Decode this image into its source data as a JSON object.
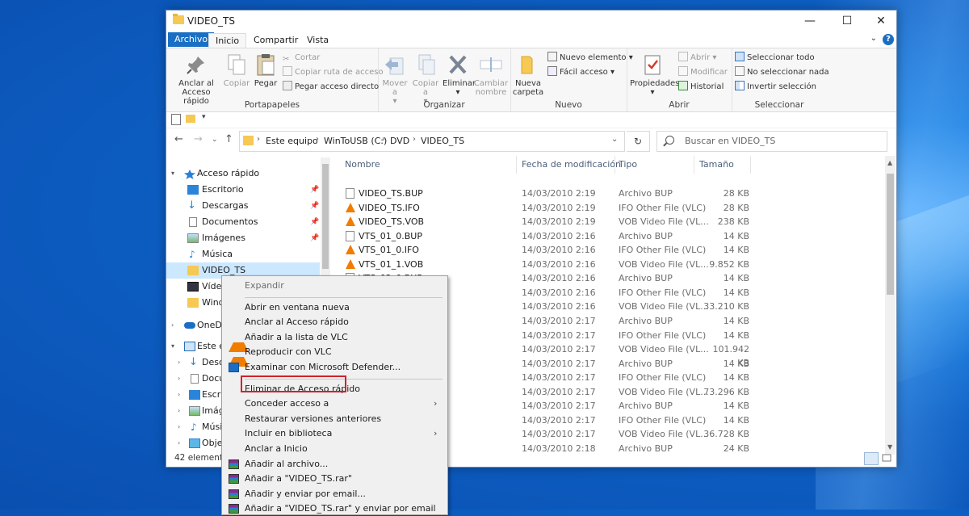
{
  "window": {
    "title": "VIDEO_TS",
    "minimize": "—",
    "maximize": "☐",
    "close": "✕"
  },
  "ribbon_tabs": [
    "Archivo",
    "Inicio",
    "Compartir",
    "Vista"
  ],
  "ribbon": {
    "portapapeles": {
      "label": "Portapapeles",
      "pin": "Anclar al Acceso rápido",
      "copy": "Copiar",
      "paste": "Pegar",
      "cut": "Cortar",
      "copy_path": "Copiar ruta de acceso",
      "paste_shortcut": "Pegar acceso directo"
    },
    "organizar": {
      "label": "Organizar",
      "move": "Mover a",
      "copy_to": "Copiar a",
      "delete": "Eliminar",
      "rename": "Cambiar nombre"
    },
    "nuevo": {
      "label": "Nuevo",
      "new_folder": "Nueva carpeta",
      "new_item": "Nuevo elemento",
      "easy_access": "Fácil acceso"
    },
    "abrir": {
      "label": "Abrir",
      "properties": "Propiedades",
      "open": "Abrir",
      "edit": "Modificar",
      "history": "Historial"
    },
    "seleccionar": {
      "label": "Seleccionar",
      "select_all": "Seleccionar todo",
      "select_none": "No seleccionar nada",
      "invert": "Invertir selección"
    }
  },
  "address": {
    "crumbs": [
      "Este equipo",
      "WinToUSB (C:)",
      "DVD",
      "VIDEO_TS"
    ],
    "search_placeholder": "Buscar en VIDEO_TS"
  },
  "nav": {
    "quick_access": "Acceso rápido",
    "items": [
      "Escritorio",
      "Descargas",
      "Documentos",
      "Imágenes",
      "Música",
      "VIDEO_TS",
      "Víde",
      "Wind"
    ],
    "onedrive": "OneDr",
    "this_pc": "Este ec",
    "pc_items": [
      "Desca",
      "Docu",
      "Escri",
      "Imág",
      "Músi",
      "Objet"
    ]
  },
  "columns": {
    "name": "Nombre",
    "date": "Fecha de modificación",
    "type": "Tipo",
    "size": "Tamaño"
  },
  "files": [
    {
      "name": "VIDEO_TS.BUP",
      "date": "14/03/2010 2:19",
      "type": "Archivo BUP",
      "size": "28 KB",
      "icon": "doc"
    },
    {
      "name": "VIDEO_TS.IFO",
      "date": "14/03/2010 2:19",
      "type": "IFO Other File (VLC)",
      "size": "28 KB",
      "icon": "vlc"
    },
    {
      "name": "VIDEO_TS.VOB",
      "date": "14/03/2010 2:19",
      "type": "VOB Video File (VL...",
      "size": "238 KB",
      "icon": "vlc"
    },
    {
      "name": "VTS_01_0.BUP",
      "date": "14/03/2010 2:16",
      "type": "Archivo BUP",
      "size": "14 KB",
      "icon": "doc"
    },
    {
      "name": "VTS_01_0.IFO",
      "date": "14/03/2010 2:16",
      "type": "IFO Other File (VLC)",
      "size": "14 KB",
      "icon": "vlc"
    },
    {
      "name": "VTS_01_1.VOB",
      "date": "14/03/2010 2:16",
      "type": "VOB Video File (VL...",
      "size": "9.852 KB",
      "icon": "vlc"
    },
    {
      "name": "VTS_02_0.BUP",
      "date": "14/03/2010 2:16",
      "type": "Archivo BUP",
      "size": "14 KB",
      "icon": "doc"
    },
    {
      "name": "",
      "date": "14/03/2010 2:16",
      "type": "IFO Other File (VLC)",
      "size": "14 KB",
      "icon": ""
    },
    {
      "name": "",
      "date": "14/03/2010 2:16",
      "type": "VOB Video File (VL...",
      "size": "33.210 KB",
      "icon": ""
    },
    {
      "name": "",
      "date": "14/03/2010 2:17",
      "type": "Archivo BUP",
      "size": "14 KB",
      "icon": ""
    },
    {
      "name": "",
      "date": "14/03/2010 2:17",
      "type": "IFO Other File (VLC)",
      "size": "14 KB",
      "icon": ""
    },
    {
      "name": "",
      "date": "14/03/2010 2:17",
      "type": "VOB Video File (VL...",
      "size": "101.942 KB",
      "icon": ""
    },
    {
      "name": "",
      "date": "14/03/2010 2:17",
      "type": "Archivo BUP",
      "size": "14 KB",
      "icon": ""
    },
    {
      "name": "",
      "date": "14/03/2010 2:17",
      "type": "IFO Other File (VLC)",
      "size": "14 KB",
      "icon": ""
    },
    {
      "name": "",
      "date": "14/03/2010 2:17",
      "type": "VOB Video File (VL...",
      "size": "73.296 KB",
      "icon": ""
    },
    {
      "name": "",
      "date": "14/03/2010 2:17",
      "type": "Archivo BUP",
      "size": "14 KB",
      "icon": ""
    },
    {
      "name": "",
      "date": "14/03/2010 2:17",
      "type": "IFO Other File (VLC)",
      "size": "14 KB",
      "icon": ""
    },
    {
      "name": "",
      "date": "14/03/2010 2:17",
      "type": "VOB Video File (VL...",
      "size": "36.728 KB",
      "icon": ""
    },
    {
      "name": "",
      "date": "14/03/2010 2:18",
      "type": "Archivo BUP",
      "size": "24 KB",
      "icon": ""
    }
  ],
  "status": {
    "count": "42 elemento"
  },
  "context_menu": [
    {
      "label": "Expandir",
      "disabled": true,
      "icon": ""
    },
    {
      "sep": true
    },
    {
      "label": "Abrir en ventana nueva",
      "icon": ""
    },
    {
      "label": "Anclar al Acceso rápido",
      "icon": ""
    },
    {
      "label": "Añadir a la lista de VLC",
      "icon": "vlc"
    },
    {
      "label": "Reproducir con VLC",
      "icon": "vlc"
    },
    {
      "label": "Examinar con Microsoft Defender...",
      "icon": "defender"
    },
    {
      "sep": true
    },
    {
      "label": "Eliminar de Acceso rápido",
      "icon": ""
    },
    {
      "label": "Conceder acceso a",
      "icon": "",
      "submenu": true
    },
    {
      "label": "Restaurar versiones anteriores",
      "icon": ""
    },
    {
      "label": "Incluir en biblioteca",
      "icon": "",
      "submenu": true
    },
    {
      "label": "Anclar a Inicio",
      "icon": ""
    },
    {
      "label": "Añadir al archivo...",
      "icon": "rar"
    },
    {
      "label": "Añadir a \"VIDEO_TS.rar\"",
      "icon": "rar"
    },
    {
      "label": "Añadir y enviar por email...",
      "icon": "rar"
    },
    {
      "label": "Añadir a \"VIDEO_TS.rar\" y enviar por email",
      "icon": "rar"
    }
  ]
}
